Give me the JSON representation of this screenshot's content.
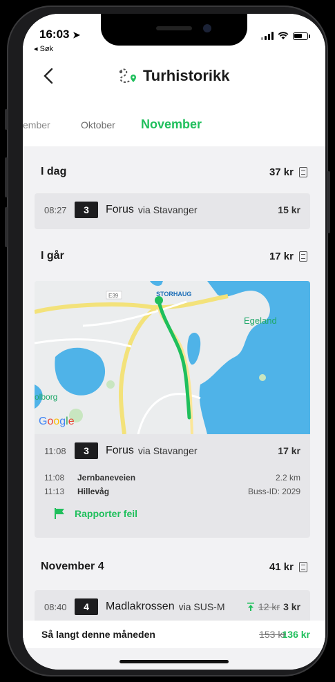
{
  "status_bar": {
    "time": "16:03",
    "back_app": "◂ Søk"
  },
  "header": {
    "title": "Turhistorikk"
  },
  "month_tabs": {
    "prev2": "ember",
    "prev1": "Oktober",
    "active": "November"
  },
  "days": [
    {
      "label": "I dag",
      "total": "37 kr",
      "trips": [
        {
          "time": "08:27",
          "route": "3",
          "destination": "Forus",
          "via": "via Stavanger",
          "price": "15 kr"
        }
      ]
    },
    {
      "label": "I går",
      "total": "17 kr",
      "trips": [
        {
          "time": "11:08",
          "route": "3",
          "destination": "Forus",
          "via": "via Stavanger",
          "price": "17 kr",
          "map": {
            "labels": [
              "STORHAUG",
              "Egeland",
              "olborg",
              "E39"
            ],
            "provider": "Google"
          },
          "stops": [
            {
              "time": "11:08",
              "name": "Jernbaneveien",
              "info": "2.2 km"
            },
            {
              "time": "11:13",
              "name": "Hillevåg",
              "info": "Buss-ID: 2029"
            }
          ],
          "report_label": "Rapporter feil"
        }
      ]
    },
    {
      "label": "November 4",
      "total": "41 kr",
      "trips": [
        {
          "time": "08:40",
          "route": "4",
          "destination": "Madlakrossen",
          "via": "via SUS-M",
          "old_price": "12 kr",
          "price": "3 kr"
        }
      ]
    }
  ],
  "month_summary": {
    "label": "Så langt denne måneden",
    "old_total": "153 kr",
    "total": "136 kr"
  },
  "colors": {
    "accent": "#1fbf5c",
    "water": "#4fb3e8",
    "route": "#1fbf5c",
    "road": "#f3e27a"
  }
}
